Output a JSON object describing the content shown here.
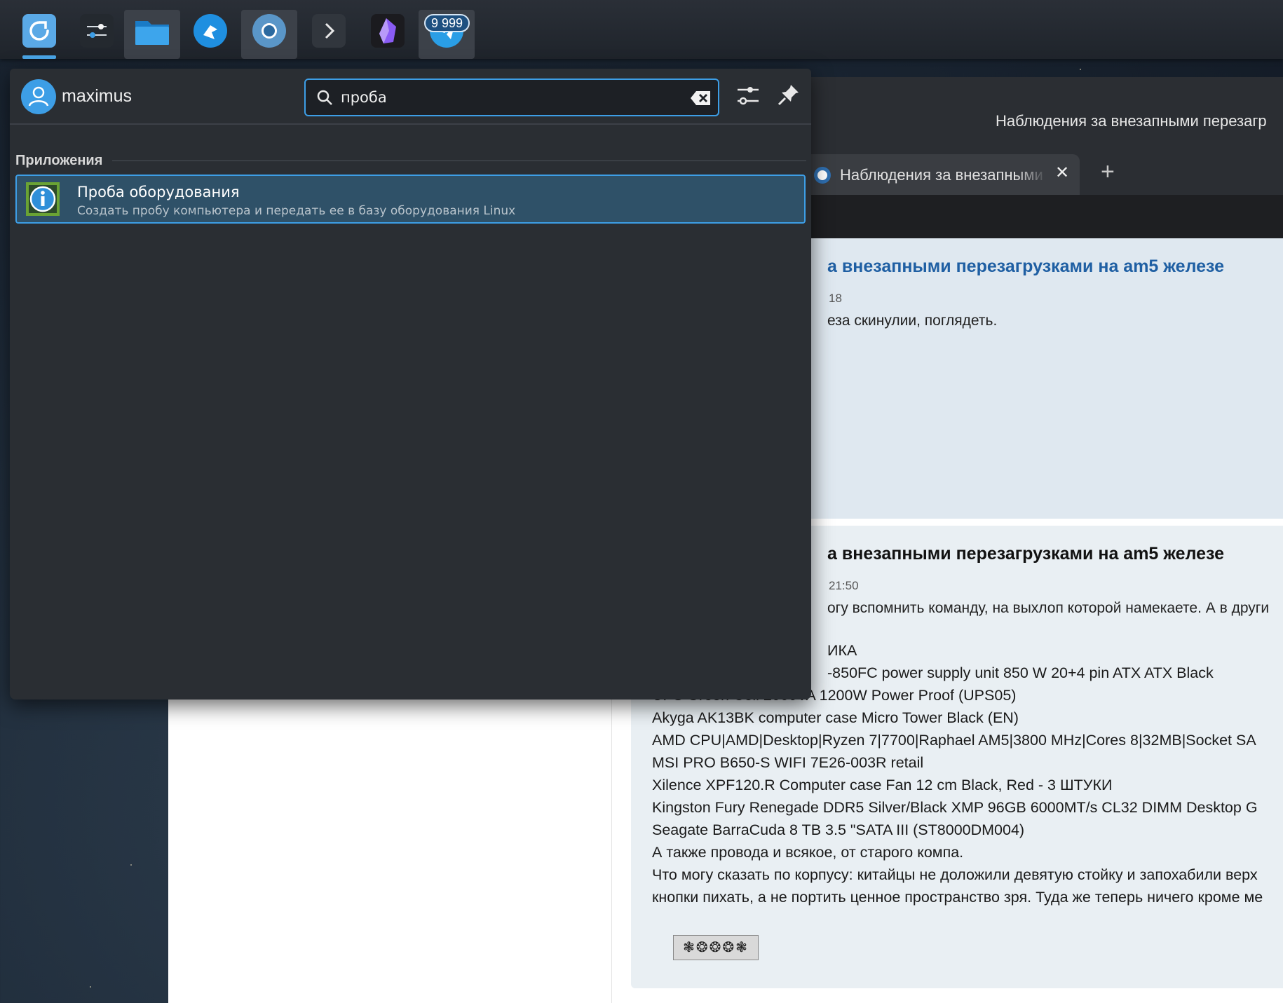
{
  "taskbar": {
    "items": [
      {
        "name": "application-launcher",
        "active": true
      },
      {
        "name": "system-settings"
      },
      {
        "name": "dolphin-file-manager",
        "active": true
      },
      {
        "name": "kdeconnect"
      },
      {
        "name": "chromium-browser",
        "active": true
      },
      {
        "name": "konsole-terminal"
      },
      {
        "name": "obsidian"
      },
      {
        "name": "telegram",
        "badge": "9 999"
      }
    ],
    "telegram_badge": "9 999"
  },
  "launcher": {
    "username": "maximus",
    "search": {
      "value": "проба",
      "placeholder": ""
    },
    "section_title": "Приложения",
    "results": [
      {
        "title": "Проба оборудования",
        "description": "Создать пробу компьютера и передать ее в базу оборудования Linux"
      }
    ],
    "colors": {
      "accent": "#3d9ee6",
      "background": "#2a2e33",
      "highlight": "#2f5168"
    }
  },
  "browser": {
    "window_title": "Наблюдения за внезапными перезагр",
    "tab_title": "Наблюдения за внезапными",
    "tab_close": "✕",
    "new_tab": "+",
    "post1": {
      "title": "а внезапными перезагрузками на am5 железе",
      "date": "18",
      "text": "еза скинулии, поглядеть."
    },
    "post2": {
      "title": "а внезапными перезагрузками на am5 железе",
      "date": "21:50",
      "text": "огу вспомнить команду, на выхлоп которой намекаете. А в други",
      "lines": [
        "ИКА",
        "-850FC power supply unit 850 W 20+4 pin ATX ATX Black",
        "UPS Green Cell 2000VA 1200W Power Proof (UPS05)",
        "Akyga AK13BK computer case Micro Tower Black (EN)",
        "AMD CPU|AMD|Desktop|Ryzen 7|7700|Raphael AM5|3800 MHz|Cores 8|32MB|Socket SA",
        "MSI PRO B650-S WIFI 7E26-003R retail",
        "Xilence XPF120.R Computer case Fan 12 cm Black, Red - 3 ШТУКИ",
        "Kingston Fury Renegade DDR5 Silver/Black XMP 96GB 6000MT/s CL32 DIMM Desktop G",
        "Seagate BarraCuda 8 TB 3.5 \"SATA III (ST8000DM004)",
        "А также провода и всякое, от старого компа.",
        "Что могу сказать по корпусу: китайцы не доложили девятую стойку и запохабили верх",
        "кнопки пихать, а не портить ценное пространство зря. Туда же теперь ничего кроме ме"
      ],
      "emoji_strip": "❃❂❂❂❃"
    }
  }
}
